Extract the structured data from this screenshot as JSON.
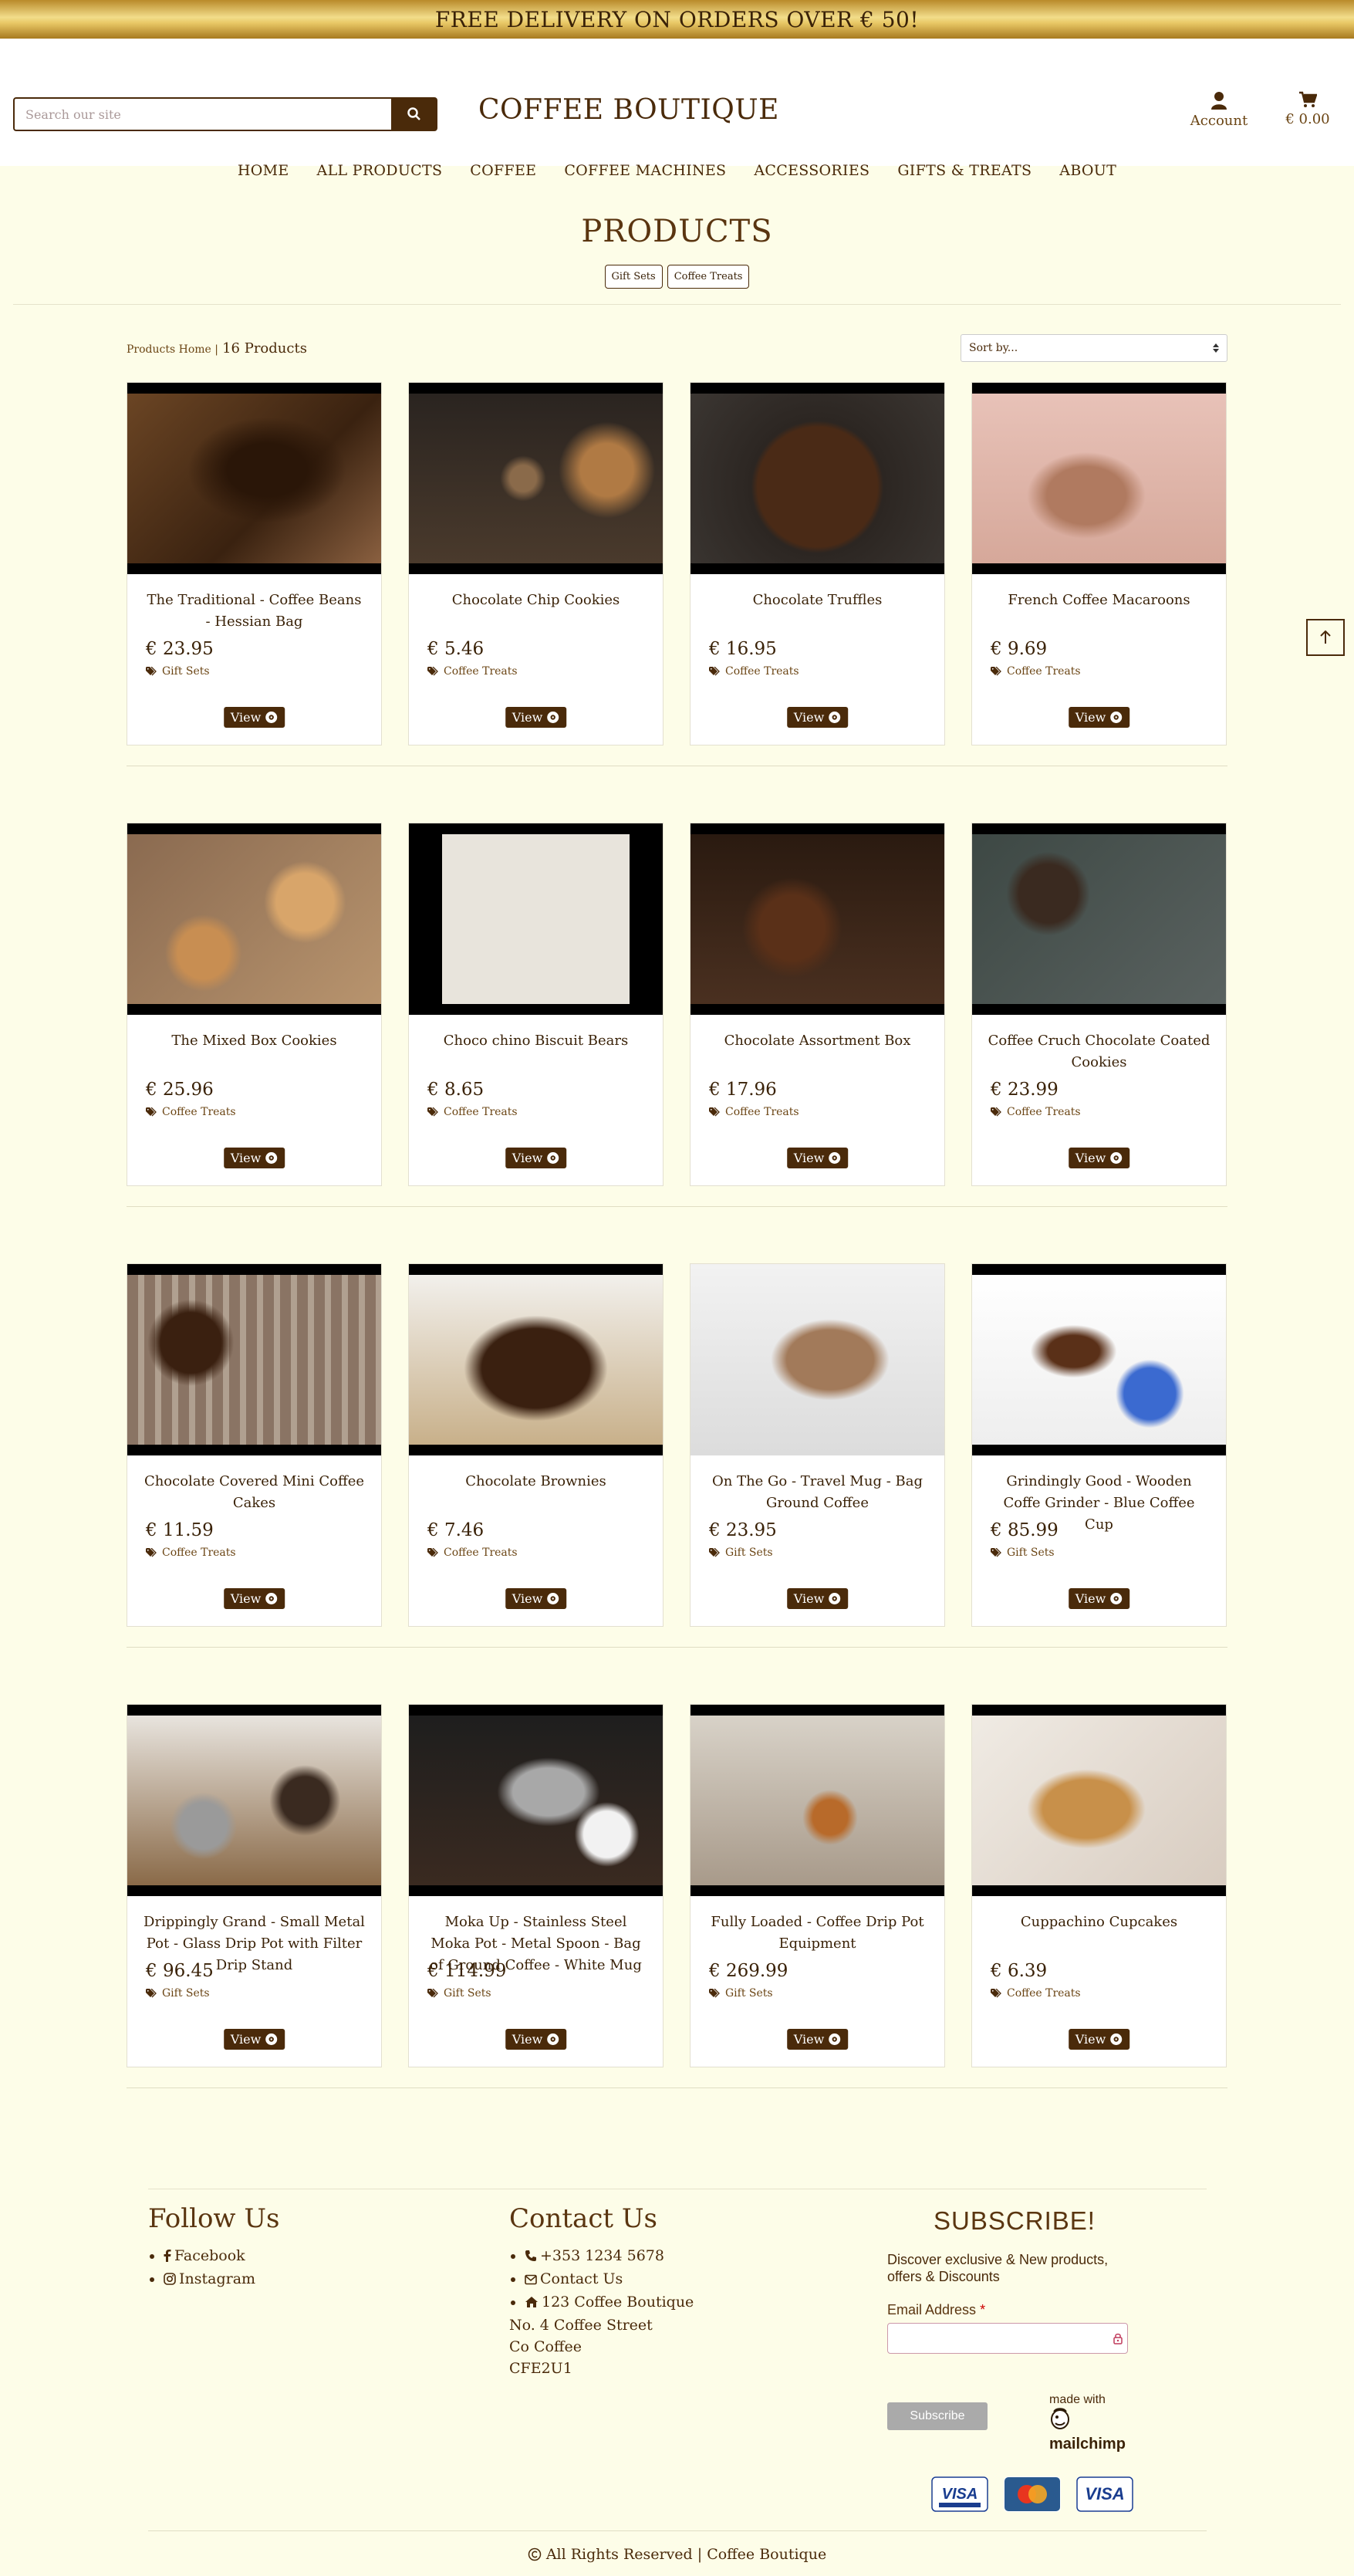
{
  "banner": {
    "text": "FREE DELIVERY ON ORDERS OVER € 50!"
  },
  "header": {
    "search_placeholder": "Search our site",
    "logo": "COFFEE BOUTIQUE",
    "account_label": "Account",
    "cart_total": "€ 0.00"
  },
  "nav": {
    "items": [
      "HOME",
      "ALL PRODUCTS",
      "COFFEE",
      "COFFEE MACHINES",
      "ACCESSORIES",
      "GIFTS & TREATS",
      "ABOUT"
    ]
  },
  "products_page": {
    "title": "PRODUCTS",
    "filters": [
      "Gift Sets",
      "Coffee Treats"
    ],
    "breadcrumb": "Products Home |",
    "count": "16 Products",
    "sort_placeholder": "Sort by..."
  },
  "view_label": "View",
  "products": [
    {
      "title": "The Traditional - Coffee Beans - Hessian Bag",
      "price": "€ 23.95",
      "category": "Gift Sets"
    },
    {
      "title": "Chocolate Chip Cookies",
      "price": "€ 5.46",
      "category": "Coffee Treats"
    },
    {
      "title": "Chocolate Truffles",
      "price": "€ 16.95",
      "category": "Coffee Treats"
    },
    {
      "title": "French Coffee Macaroons",
      "price": "€ 9.69",
      "category": "Coffee Treats"
    },
    {
      "title": "The Mixed Box Cookies",
      "price": "€ 25.96",
      "category": "Coffee Treats"
    },
    {
      "title": "Choco chino Biscuit Bears",
      "price": "€ 8.65",
      "category": "Coffee Treats"
    },
    {
      "title": "Chocolate Assortment Box",
      "price": "€ 17.96",
      "category": "Coffee Treats"
    },
    {
      "title": "Coffee Cruch Chocolate Coated Cookies",
      "price": "€ 23.99",
      "category": "Coffee Treats"
    },
    {
      "title": "Chocolate Covered Mini Coffee Cakes",
      "price": "€ 11.59",
      "category": "Coffee Treats"
    },
    {
      "title": "Chocolate Brownies",
      "price": "€ 7.46",
      "category": "Coffee Treats"
    },
    {
      "title": "On The Go - Travel Mug - Bag Ground Coffee",
      "price": "€ 23.95",
      "category": "Gift Sets"
    },
    {
      "title": "Grindingly Good - Wooden Coffe Grinder - Blue Coffee Cup",
      "price": "€ 85.99",
      "category": "Gift Sets"
    },
    {
      "title": "Drippingly Grand - Small Metal Pot - Glass Drip Pot with Filter Drip Stand",
      "price": "€ 96.45",
      "category": "Gift Sets"
    },
    {
      "title": "Moka Up - Stainless Steel Moka Pot - Metal Spoon - Bag of Ground Coffee - White Mug",
      "price": "€ 114.99",
      "category": "Gift Sets"
    },
    {
      "title": "Fully Loaded - Coffee Drip Pot Equipment",
      "price": "€ 269.99",
      "category": "Gift Sets"
    },
    {
      "title": "Cuppachino Cupcakes",
      "price": "€ 6.39",
      "category": "Coffee Treats"
    }
  ],
  "footer": {
    "follow_title": "Follow Us",
    "social": [
      "Facebook",
      "Instagram"
    ],
    "contact_title": "Contact Us",
    "phone": "+353 1234 5678",
    "email_link": "Contact Us",
    "address_line1": "123 Coffee Boutique",
    "address_line2": "No. 4 Coffee Street",
    "address_line3": "Co Coffee",
    "address_line4": "CFE2U1",
    "subscribe_title": "SUBSCRIBE!",
    "subscribe_text": "Discover exclusive & New products, offers & Discounts",
    "email_label": "Email Address",
    "required_mark": "*",
    "subscribe_button": "Subscribe",
    "made_with": "made with",
    "mailchimp": "mailchimp",
    "copyright": "All Rights Reserved | Coffee Boutique"
  },
  "colors": {
    "brand": "#4a2a0a",
    "background": "#fdfde8",
    "banner_gold": "#e8c765"
  }
}
